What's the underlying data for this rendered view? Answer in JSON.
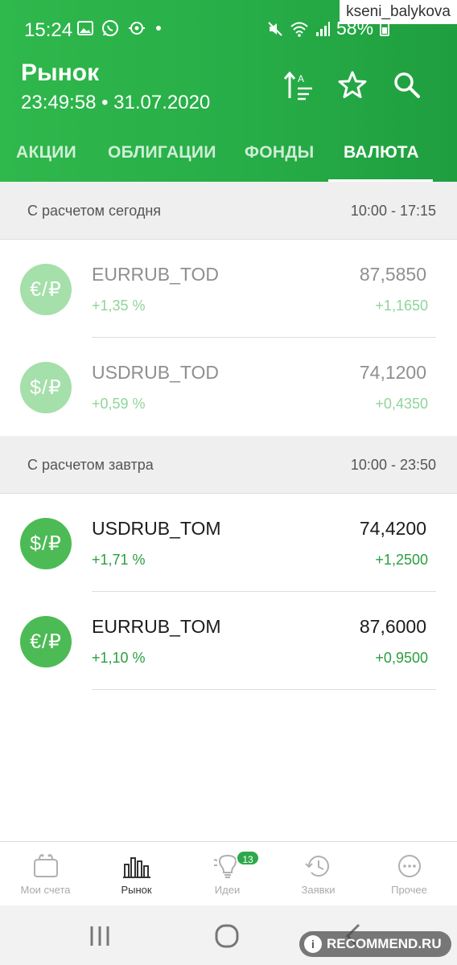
{
  "status_bar": {
    "time": "15:24",
    "left_icons": [
      "image-icon",
      "whatsapp-icon",
      "vpn-icon",
      "dot-icon"
    ],
    "right_icons": [
      "mute-icon",
      "wifi-icon",
      "signal-icon",
      "battery-icon"
    ],
    "battery": "58%"
  },
  "watermark": "kseni_balykova",
  "header": {
    "title": "Рынок",
    "subtitle": "23:49:58 • 31.07.2020",
    "actions": [
      "sort-icon",
      "star-icon",
      "search-icon"
    ]
  },
  "tabs": [
    {
      "label": "АКЦИИ",
      "active": false
    },
    {
      "label": "ОБЛИГАЦИИ",
      "active": false
    },
    {
      "label": "ФОНДЫ",
      "active": false
    },
    {
      "label": "ВАЛЮТА",
      "active": true
    }
  ],
  "sections": [
    {
      "label": "С расчетом сегодня",
      "hours": "10:00 - 17:15",
      "items": [
        {
          "icon_text": "€/₽",
          "ticker": "EURRUB_TOD",
          "change_pct": "+1,35  %",
          "price": "87,5850",
          "change": "+1,1650",
          "state": "dim"
        },
        {
          "icon_text": "$/₽",
          "ticker": "USDRUB_TOD",
          "change_pct": "+0,59  %",
          "price": "74,1200",
          "change": "+0,4350",
          "state": "dim"
        }
      ]
    },
    {
      "label": "С расчетом завтра",
      "hours": "10:00 - 23:50",
      "items": [
        {
          "icon_text": "$/₽",
          "ticker": "USDRUB_TOM",
          "change_pct": "+1,71  %",
          "price": "74,4200",
          "change": "+1,2500",
          "state": "live"
        },
        {
          "icon_text": "€/₽",
          "ticker": "EURRUB_TOM",
          "change_pct": "+1,10  %",
          "price": "87,6000",
          "change": "+0,9500",
          "state": "live"
        }
      ]
    }
  ],
  "bottom_nav": [
    {
      "label": "Мои счета",
      "icon": "wallet-icon",
      "active": false
    },
    {
      "label": "Рынок",
      "icon": "market-chart-icon",
      "active": true
    },
    {
      "label": "Идеи",
      "icon": "lightbulb-icon",
      "active": false,
      "badge": "13"
    },
    {
      "label": "Заявки",
      "icon": "history-clock-icon",
      "active": false
    },
    {
      "label": "Прочее",
      "icon": "more-dots-icon",
      "active": false
    }
  ],
  "system_nav": [
    "recent-apps-icon",
    "home-icon",
    "back-icon"
  ],
  "recommend_logo": "RECOMMEND.RU",
  "colors": {
    "header_green": "#27ad47",
    "positive_green": "#2a9f3e",
    "muted_green": "#8fd59a",
    "badge_green": "#2ea84a"
  }
}
